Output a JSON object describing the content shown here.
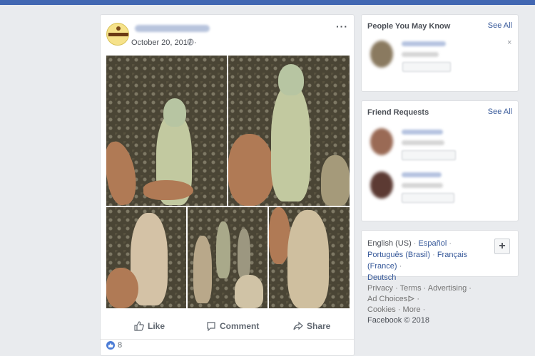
{
  "post": {
    "date": "October 20, 2017 ·",
    "more_label": "···",
    "actions": {
      "like": "Like",
      "comment": "Comment",
      "share": "Share"
    },
    "reaction_count": "8"
  },
  "people_you_may_know": {
    "title": "People You May Know",
    "see_all": "See All",
    "close": "×"
  },
  "friend_requests": {
    "title": "Friend Requests",
    "see_all": "See All"
  },
  "languages": {
    "current": "English (US)",
    "espanol": "Español",
    "portugues": "Português (Brasil)",
    "francais": "Français (France)",
    "deutsch": "Deutsch",
    "plus": "+"
  },
  "footer": {
    "privacy": "Privacy",
    "terms": "Terms",
    "advertising": "Advertising",
    "ad_choices": "Ad Choices",
    "cookies": "Cookies",
    "more": "More",
    "copyright": "Facebook © 2018"
  },
  "colors": {
    "brand_blue": "#4267b2",
    "link_blue": "#365899",
    "page_bg": "#e9ebee"
  }
}
